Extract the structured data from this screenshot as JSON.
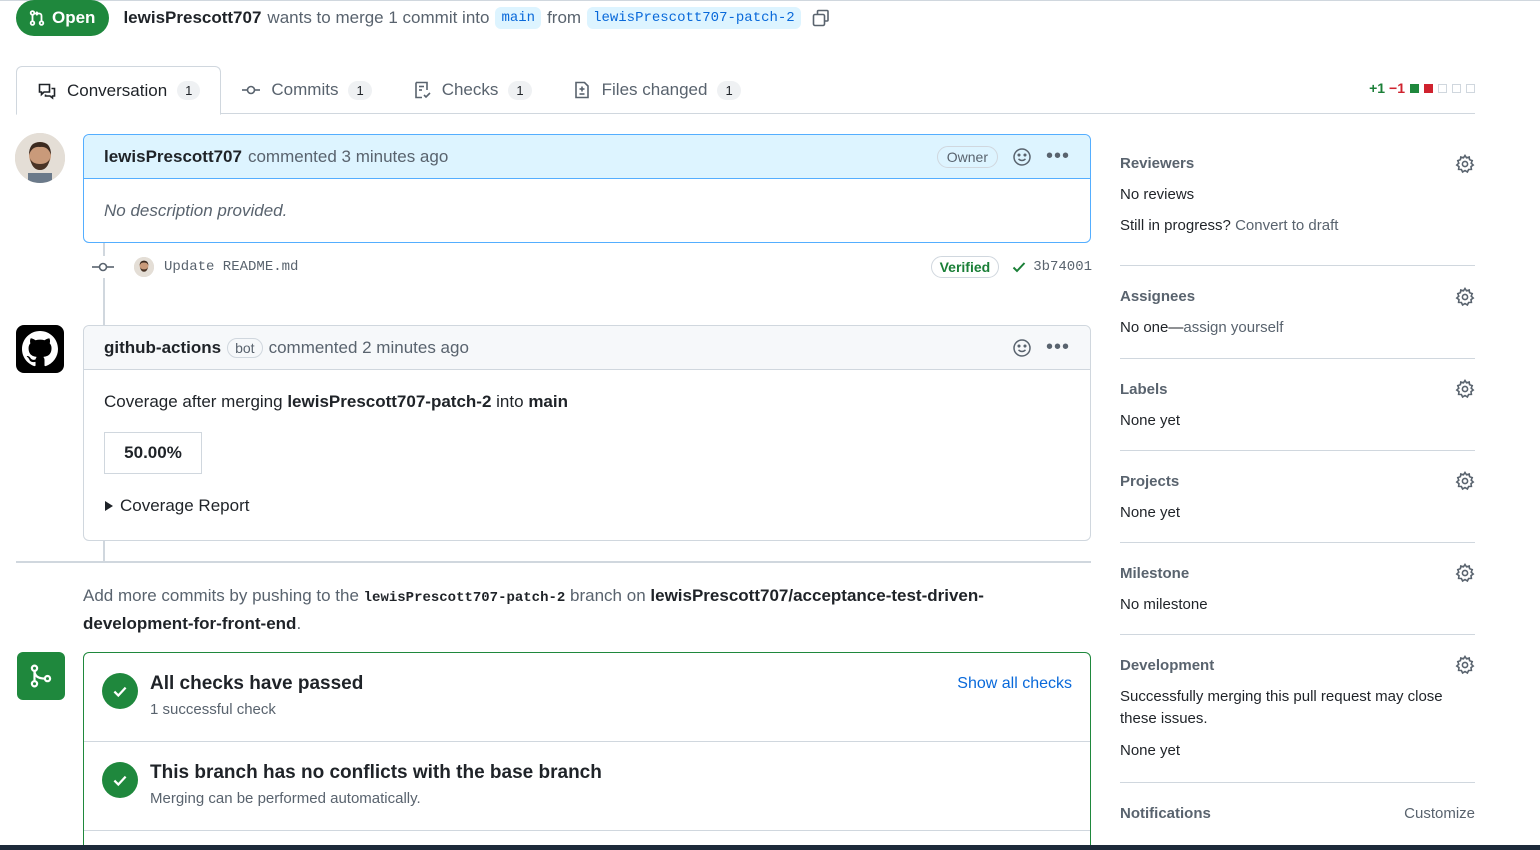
{
  "header": {
    "state": "Open",
    "author": "lewisPrescott707",
    "text_wants": "wants to merge 1 commit into",
    "base_branch": "main",
    "text_from": "from",
    "head_branch": "lewisPrescott707-patch-2"
  },
  "tabs": [
    {
      "label": "Conversation",
      "count": "1"
    },
    {
      "label": "Commits",
      "count": "1"
    },
    {
      "label": "Checks",
      "count": "1"
    },
    {
      "label": "Files changed",
      "count": "1"
    }
  ],
  "diffstat": {
    "additions": "+1",
    "deletions": "−1"
  },
  "comment1": {
    "author": "lewisPrescott707",
    "meta": "commented 3 minutes ago",
    "role": "Owner",
    "body": "No description provided."
  },
  "commit": {
    "message": "Update README.md",
    "verified": "Verified",
    "sha": "3b74001"
  },
  "comment2": {
    "author": "github-actions",
    "bot_label": "bot",
    "meta": "commented 2 minutes ago",
    "body_prefix": "Coverage after merging",
    "body_branch": "lewisPrescott707-patch-2",
    "body_into": "into",
    "body_base": "main",
    "coverage": "50.00%",
    "details_label": "Coverage Report"
  },
  "push_hint": {
    "prefix": "Add more commits by pushing to the",
    "branch": "lewisPrescott707-patch-2",
    "middle": "branch on",
    "repo": "lewisPrescott707/acceptance-test-driven-development-for-front-end",
    "suffix": "."
  },
  "merge": {
    "checks_title": "All checks have passed",
    "checks_sub": "1 successful check",
    "show_checks": "Show all checks",
    "conflicts_title": "This branch has no conflicts with the base branch",
    "conflicts_sub": "Merging can be performed automatically."
  },
  "sidebar": {
    "reviewers": {
      "title": "Reviewers",
      "value": "No reviews",
      "progress_q": "Still in progress?",
      "convert": "Convert to draft"
    },
    "assignees": {
      "title": "Assignees",
      "value_prefix": "No one—",
      "value_link": "assign yourself"
    },
    "labels": {
      "title": "Labels",
      "value": "None yet"
    },
    "projects": {
      "title": "Projects",
      "value": "None yet"
    },
    "milestone": {
      "title": "Milestone",
      "value": "No milestone"
    },
    "development": {
      "title": "Development",
      "desc": "Successfully merging this pull request may close these issues.",
      "value": "None yet"
    },
    "notifications": {
      "title": "Notifications",
      "action": "Customize"
    }
  },
  "colors": {
    "accent": "#0969da",
    "success": "#1f883d",
    "danger": "#cf222e"
  }
}
